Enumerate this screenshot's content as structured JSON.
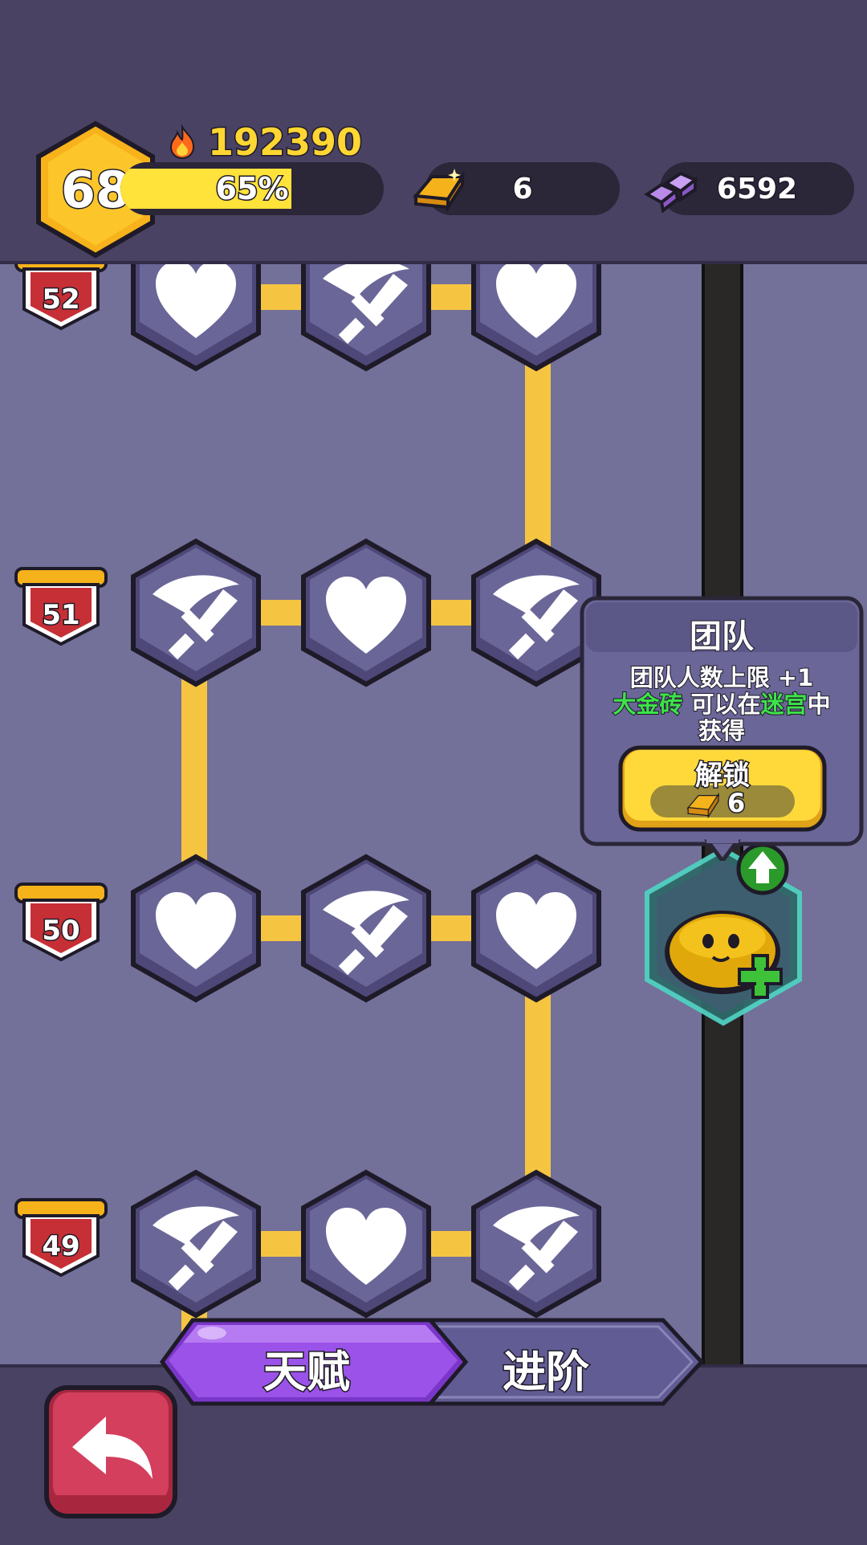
{
  "header": {
    "level": "68",
    "score": "192390",
    "xp_percent": 0.65,
    "xp_label": "65%",
    "gold_bars": "6",
    "gems": "6592"
  },
  "rows": [
    {
      "level_label": "52",
      "nodes": [
        "heart-icon",
        "sword-icon",
        "heart-icon"
      ]
    },
    {
      "level_label": "51",
      "nodes": [
        "sword-icon",
        "heart-icon",
        "sword-icon"
      ]
    },
    {
      "level_label": "50",
      "nodes": [
        "heart-icon",
        "sword-icon",
        "heart-icon"
      ]
    },
    {
      "level_label": "49",
      "nodes": [
        "sword-icon",
        "heart-icon",
        "sword-icon"
      ]
    }
  ],
  "tooltip": {
    "title": "团队",
    "line1": "团队人数上限 +1",
    "line2_a": "大金砖",
    "line2_b": "可以在",
    "line2_c": "迷宫",
    "line2_d": "中",
    "line3": "获得",
    "unlock_label": "解锁",
    "unlock_cost": "6"
  },
  "tabs": {
    "active": "天赋",
    "inactive": "进阶"
  },
  "colors": {
    "accent_yellow": "#f5c542",
    "node_purple": "#6a6697",
    "active_tab": "#9b52e8",
    "back_button": "#d33f5d",
    "highlight_text": "#3ee24a"
  }
}
